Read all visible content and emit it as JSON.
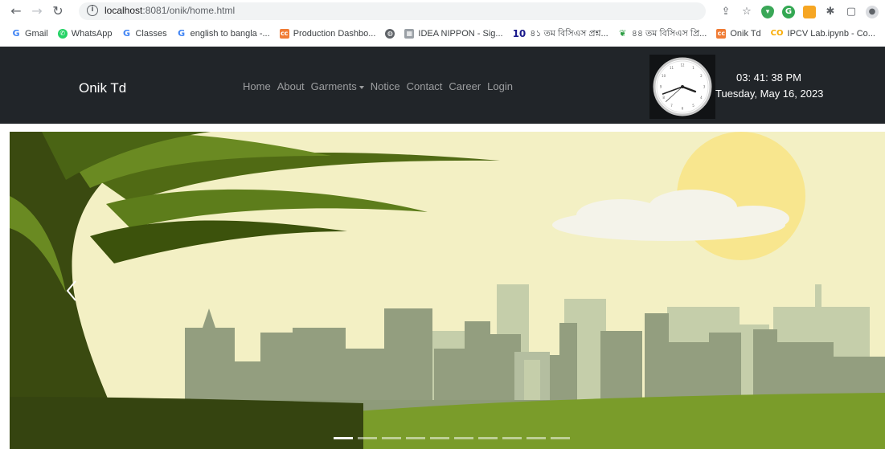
{
  "browser": {
    "url_host": "localhost",
    "url_rest": ":8081/onik/home.html",
    "bookmarks": [
      {
        "label": "Gmail",
        "icon": "google-icon"
      },
      {
        "label": "WhatsApp",
        "icon": "whatsapp-icon"
      },
      {
        "label": "Classes",
        "icon": "google-icon"
      },
      {
        "label": "english to bangla -...",
        "icon": "google-icon"
      },
      {
        "label": "Production Dashbo...",
        "icon": "codecanyon-icon"
      },
      {
        "label": "",
        "icon": "globe-icon"
      },
      {
        "label": "IDEA NIPPON - Sig...",
        "icon": "idea-icon"
      },
      {
        "label": "৪১ তম বিসিএস প্রশ্ন...",
        "icon": "ten-minute-icon"
      },
      {
        "label": "৪৪ তম বিসিএস প্রি...",
        "icon": "green-leaf-icon"
      },
      {
        "label": "Onik Td",
        "icon": "codecanyon-icon"
      },
      {
        "label": "IPCV Lab.ipynb - Co...",
        "icon": "colab-icon"
      }
    ]
  },
  "navbar": {
    "brand": "Onik Td",
    "links": [
      "Home",
      "About",
      "Garments",
      "Notice",
      "Contact",
      "Career",
      "Login"
    ],
    "dropdown_link": "Garments",
    "clock": {
      "time": "03: 41: 38 PM",
      "date": "Tuesday, May 16, 2023",
      "hour": 3,
      "minute": 41,
      "second": 38
    }
  },
  "carousel": {
    "slide_count": 10,
    "active_index": 0,
    "colors": {
      "sky": "#f3f0c4",
      "sun": "#f8e68e",
      "cloud": "#f4f3ea",
      "city_back": "#c5ceaa",
      "city_front": "#939e7f",
      "grass": "#7a9c2a",
      "tree_dark": "#2e3d0b",
      "tree_light": "#5d7d1b"
    }
  },
  "colors": {
    "navbar_bg": "#212529",
    "brand": "#ffffff",
    "nav_link": "#8b8d90"
  }
}
